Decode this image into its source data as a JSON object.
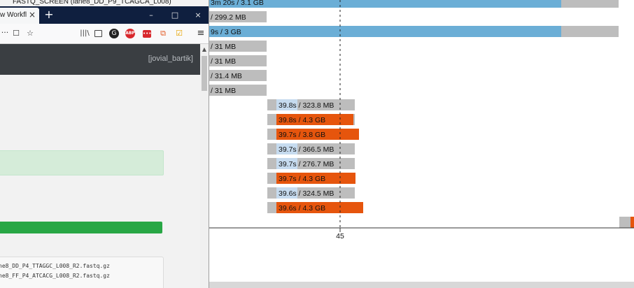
{
  "background_window": {
    "title": "FASTQ_SCREEN (lane8_DD_P9_TCAGCA_L008)"
  },
  "browser": {
    "tab_title": "w Workfl",
    "tab_close": "×",
    "new_tab": "+",
    "window_controls": {
      "minimize": "–",
      "maximize": "□",
      "close": "×"
    },
    "toolbar": {
      "more": "···",
      "pocket": "☐",
      "star": "☆",
      "library": "|||\\",
      "sidebar": "",
      "ghost": "G",
      "abp": "ABP",
      "ext1": "•••",
      "ext2": "⧉",
      "ext3": "☑",
      "menu": "≡"
    }
  },
  "app": {
    "user": "[jovial_bartik]",
    "files": [
      "ne8_DD_P4_TTAGGC_L008_R2.fastq.gz",
      "ne8_FF_P4_ATCACG_L008_R2.fastq.gz"
    ],
    "colors": {
      "header": "#3a3e42",
      "success": "#d5ecd9",
      "progress": "#28a745"
    }
  },
  "chart_data": {
    "type": "timeline",
    "tick_label": "45",
    "colors": {
      "blue": "#6baed6",
      "orange": "#e6550d",
      "gray": "#bdbdbd",
      "light_blue": "#c6dbef"
    },
    "rows": [
      {
        "label": "3m 20s / 3.1 GB",
        "kind": "blue"
      },
      {
        "label": "/ 299.2 MB",
        "kind": "gray"
      },
      {
        "label": "9s / 3 GB",
        "kind": "blue"
      },
      {
        "label": "/ 31 MB",
        "kind": "gray"
      },
      {
        "label": "/ 31 MB",
        "kind": "gray"
      },
      {
        "label": "/ 31.4 MB",
        "kind": "gray"
      },
      {
        "label": "/ 31 MB",
        "kind": "gray"
      },
      {
        "label": "39.8s / 323.8 MB",
        "kind": "light"
      },
      {
        "label": "39.8s / 4.3 GB",
        "kind": "orange"
      },
      {
        "label": "39.7s / 3.8 GB",
        "kind": "orange"
      },
      {
        "label": "39.7s / 366.5 MB",
        "kind": "light"
      },
      {
        "label": "39.7s / 276.7 MB",
        "kind": "light"
      },
      {
        "label": "39.7s / 4.3 GB",
        "kind": "orange"
      },
      {
        "label": "39.6s / 324.5 MB",
        "kind": "light"
      },
      {
        "label": "39.6s / 4.3 GB",
        "kind": "orange"
      },
      {
        "label": "",
        "kind": "tail"
      }
    ]
  }
}
